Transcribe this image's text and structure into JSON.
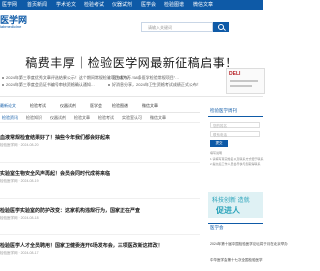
{
  "nav": {
    "items": [
      "医学网",
      "首页新闻",
      "学术论文",
      "检验考试",
      "仪器试剂",
      "医学会",
      "检验图谱",
      "微信文章"
    ]
  },
  "header": {
    "logo_text": "医学网",
    "logo_sub": "labmedicine",
    "search_placeholder": "请输入关键词"
  },
  "banner": {
    "title": "稿费丰厚｜检验医学网最新征稿启事！"
  },
  "notices": {
    "left": [
      "2024年第三季度优秀文章评选结果公示！这个期间常规检验项目成为万…",
      "2024年第三季度会员证书编号审核资格确认通知…"
    ],
    "right": [
      "官方发布！“58条医学检验常规项目”…",
      "好消息分享，2024年卫生资格考试成绩正式公布！"
    ]
  },
  "ad": {
    "brand": "DELI"
  },
  "tabs": {
    "items": [
      "最新论文",
      "检验考试",
      "仪器试剂",
      "医学会",
      "检验图谱",
      "微信文章"
    ]
  },
  "subtabs": {
    "items": [
      "检验资讯",
      "检验知识",
      "仪器试剂",
      "检验文章",
      "检验考试",
      "实验室认可",
      "微信文章"
    ]
  },
  "articles": [
    {
      "title": "血液常规检查结果好了！抽些今年我们都会好起来",
      "meta": "检验医学网 · 2024-08-20"
    },
    {
      "title": "实验室生物安全风声再起！会员会同时代成将来临",
      "meta": "检验医学网 · 2024-08-19"
    },
    {
      "title": "检验医学实验室的防护改变：这家机构违规行为，国家正在严查",
      "meta": "检验医学网 · 2024-08-18"
    },
    {
      "title": "检验医学人才全员聘用！国家卫健委连开6场发布会，三项医改新这样改！",
      "meta": "检验医学网 · 2024-08-17"
    }
  ],
  "sidebar": {
    "title": "检验医学周刊",
    "input_placeholder1": "您的姓名",
    "input_placeholder2": "联系电话",
    "submit_label": "提交",
    "note_title": "填写说明",
    "note_lines": [
      "1.请填写真实姓名以及联系方式便于联系",
      "2.提交后工作人员会尽快与您取得联系"
    ],
    "ad_line1": "科技创新 造就",
    "ad_line2": "促进人",
    "list_title": "医学会",
    "list_items": [
      "2024年第十届中国检验医学论坛将于月在北京举办",
      "中华医学会第十七次全国检验医学"
    ]
  }
}
